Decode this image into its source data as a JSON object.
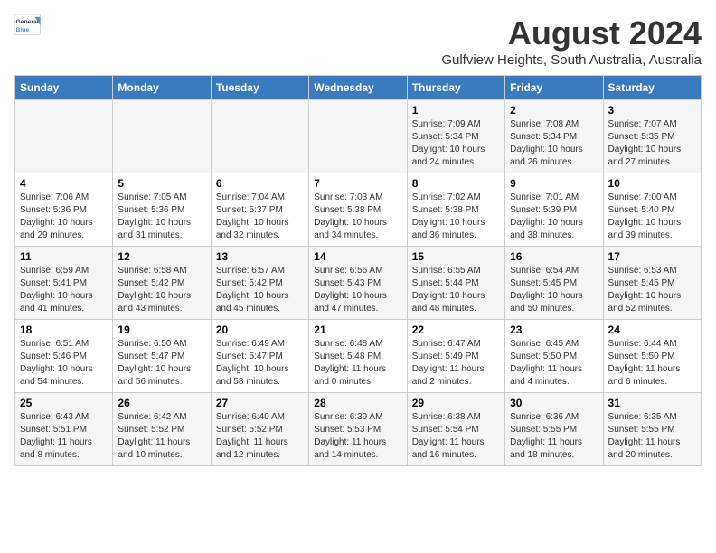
{
  "header": {
    "logo_general": "General",
    "logo_blue": "Blue",
    "title": "August 2024",
    "subtitle": "Gulfview Heights, South Australia, Australia"
  },
  "days_of_week": [
    "Sunday",
    "Monday",
    "Tuesday",
    "Wednesday",
    "Thursday",
    "Friday",
    "Saturday"
  ],
  "weeks": [
    [
      {
        "day": "",
        "info": ""
      },
      {
        "day": "",
        "info": ""
      },
      {
        "day": "",
        "info": ""
      },
      {
        "day": "",
        "info": ""
      },
      {
        "day": "1",
        "info": "Sunrise: 7:09 AM\nSunset: 5:34 PM\nDaylight: 10 hours\nand 24 minutes."
      },
      {
        "day": "2",
        "info": "Sunrise: 7:08 AM\nSunset: 5:34 PM\nDaylight: 10 hours\nand 26 minutes."
      },
      {
        "day": "3",
        "info": "Sunrise: 7:07 AM\nSunset: 5:35 PM\nDaylight: 10 hours\nand 27 minutes."
      }
    ],
    [
      {
        "day": "4",
        "info": "Sunrise: 7:06 AM\nSunset: 5:36 PM\nDaylight: 10 hours\nand 29 minutes."
      },
      {
        "day": "5",
        "info": "Sunrise: 7:05 AM\nSunset: 5:36 PM\nDaylight: 10 hours\nand 31 minutes."
      },
      {
        "day": "6",
        "info": "Sunrise: 7:04 AM\nSunset: 5:37 PM\nDaylight: 10 hours\nand 32 minutes."
      },
      {
        "day": "7",
        "info": "Sunrise: 7:03 AM\nSunset: 5:38 PM\nDaylight: 10 hours\nand 34 minutes."
      },
      {
        "day": "8",
        "info": "Sunrise: 7:02 AM\nSunset: 5:38 PM\nDaylight: 10 hours\nand 36 minutes."
      },
      {
        "day": "9",
        "info": "Sunrise: 7:01 AM\nSunset: 5:39 PM\nDaylight: 10 hours\nand 38 minutes."
      },
      {
        "day": "10",
        "info": "Sunrise: 7:00 AM\nSunset: 5:40 PM\nDaylight: 10 hours\nand 39 minutes."
      }
    ],
    [
      {
        "day": "11",
        "info": "Sunrise: 6:59 AM\nSunset: 5:41 PM\nDaylight: 10 hours\nand 41 minutes."
      },
      {
        "day": "12",
        "info": "Sunrise: 6:58 AM\nSunset: 5:42 PM\nDaylight: 10 hours\nand 43 minutes."
      },
      {
        "day": "13",
        "info": "Sunrise: 6:57 AM\nSunset: 5:42 PM\nDaylight: 10 hours\nand 45 minutes."
      },
      {
        "day": "14",
        "info": "Sunrise: 6:56 AM\nSunset: 5:43 PM\nDaylight: 10 hours\nand 47 minutes."
      },
      {
        "day": "15",
        "info": "Sunrise: 6:55 AM\nSunset: 5:44 PM\nDaylight: 10 hours\nand 48 minutes."
      },
      {
        "day": "16",
        "info": "Sunrise: 6:54 AM\nSunset: 5:45 PM\nDaylight: 10 hours\nand 50 minutes."
      },
      {
        "day": "17",
        "info": "Sunrise: 6:53 AM\nSunset: 5:45 PM\nDaylight: 10 hours\nand 52 minutes."
      }
    ],
    [
      {
        "day": "18",
        "info": "Sunrise: 6:51 AM\nSunset: 5:46 PM\nDaylight: 10 hours\nand 54 minutes."
      },
      {
        "day": "19",
        "info": "Sunrise: 6:50 AM\nSunset: 5:47 PM\nDaylight: 10 hours\nand 56 minutes."
      },
      {
        "day": "20",
        "info": "Sunrise: 6:49 AM\nSunset: 5:47 PM\nDaylight: 10 hours\nand 58 minutes."
      },
      {
        "day": "21",
        "info": "Sunrise: 6:48 AM\nSunset: 5:48 PM\nDaylight: 11 hours\nand 0 minutes."
      },
      {
        "day": "22",
        "info": "Sunrise: 6:47 AM\nSunset: 5:49 PM\nDaylight: 11 hours\nand 2 minutes."
      },
      {
        "day": "23",
        "info": "Sunrise: 6:45 AM\nSunset: 5:50 PM\nDaylight: 11 hours\nand 4 minutes."
      },
      {
        "day": "24",
        "info": "Sunrise: 6:44 AM\nSunset: 5:50 PM\nDaylight: 11 hours\nand 6 minutes."
      }
    ],
    [
      {
        "day": "25",
        "info": "Sunrise: 6:43 AM\nSunset: 5:51 PM\nDaylight: 11 hours\nand 8 minutes."
      },
      {
        "day": "26",
        "info": "Sunrise: 6:42 AM\nSunset: 5:52 PM\nDaylight: 11 hours\nand 10 minutes."
      },
      {
        "day": "27",
        "info": "Sunrise: 6:40 AM\nSunset: 5:52 PM\nDaylight: 11 hours\nand 12 minutes."
      },
      {
        "day": "28",
        "info": "Sunrise: 6:39 AM\nSunset: 5:53 PM\nDaylight: 11 hours\nand 14 minutes."
      },
      {
        "day": "29",
        "info": "Sunrise: 6:38 AM\nSunset: 5:54 PM\nDaylight: 11 hours\nand 16 minutes."
      },
      {
        "day": "30",
        "info": "Sunrise: 6:36 AM\nSunset: 5:55 PM\nDaylight: 11 hours\nand 18 minutes."
      },
      {
        "day": "31",
        "info": "Sunrise: 6:35 AM\nSunset: 5:55 PM\nDaylight: 11 hours\nand 20 minutes."
      }
    ]
  ]
}
